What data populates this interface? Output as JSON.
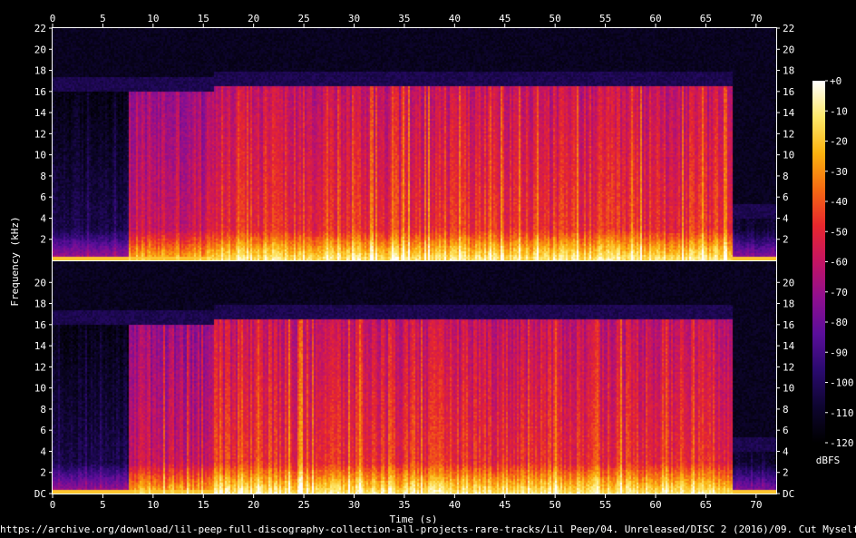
{
  "chart_data": {
    "type": "heatmap",
    "title": "",
    "xlabel": "Time (s)",
    "ylabel": "Frequency (kHz)",
    "xlim": [
      0,
      72
    ],
    "x_ticks": [
      0,
      5,
      10,
      15,
      20,
      25,
      30,
      35,
      40,
      45,
      50,
      55,
      60,
      65,
      70
    ],
    "channels": [
      {
        "ylim": [
          0,
          22
        ],
        "y_ticks": [
          {
            "value": 2,
            "label": "2"
          },
          {
            "value": 4,
            "label": "4"
          },
          {
            "value": 6,
            "label": "6"
          },
          {
            "value": 8,
            "label": "8"
          },
          {
            "value": 10,
            "label": "10"
          },
          {
            "value": 12,
            "label": "12"
          },
          {
            "value": 14,
            "label": "14"
          },
          {
            "value": 16,
            "label": "16"
          },
          {
            "value": 18,
            "label": "18"
          },
          {
            "value": 20,
            "label": "20"
          },
          {
            "value": 22,
            "label": "22"
          }
        ]
      },
      {
        "ylim": [
          0,
          22
        ],
        "y_ticks": [
          {
            "value": 0,
            "label": "DC"
          },
          {
            "value": 2,
            "label": "2"
          },
          {
            "value": 4,
            "label": "4"
          },
          {
            "value": 6,
            "label": "6"
          },
          {
            "value": 8,
            "label": "8"
          },
          {
            "value": 10,
            "label": "10"
          },
          {
            "value": 12,
            "label": "12"
          },
          {
            "value": 14,
            "label": "14"
          },
          {
            "value": 16,
            "label": "16"
          },
          {
            "value": 18,
            "label": "18"
          },
          {
            "value": 20,
            "label": "20"
          }
        ]
      }
    ],
    "colorbar": {
      "label": "dBFS",
      "range": [
        -120,
        0
      ],
      "ticks": [
        {
          "value": 0,
          "label": "+0"
        },
        {
          "value": -10,
          "label": "-10"
        },
        {
          "value": -20,
          "label": "-20"
        },
        {
          "value": -30,
          "label": "-30"
        },
        {
          "value": -40,
          "label": "-40"
        },
        {
          "value": -50,
          "label": "-50"
        },
        {
          "value": -60,
          "label": "-60"
        },
        {
          "value": -70,
          "label": "-70"
        },
        {
          "value": -80,
          "label": "-80"
        },
        {
          "value": -90,
          "label": "-90"
        },
        {
          "value": -100,
          "label": "-100"
        },
        {
          "value": -110,
          "label": "-110"
        },
        {
          "value": -120,
          "label": "-120"
        }
      ],
      "colors": [
        "#000000",
        "#0e0530",
        "#2a0a6e",
        "#5a0e9a",
        "#8f0f8f",
        "#c41463",
        "#e8272d",
        "#f56a12",
        "#fbb20f",
        "#fde86a",
        "#ffffff"
      ]
    },
    "segments": [
      {
        "t_start": 0,
        "t_end": 7.5,
        "level_db": -100,
        "cutoff_khz": 16
      },
      {
        "t_start": 7.5,
        "t_end": 16,
        "level_db": -55,
        "cutoff_khz": 16
      },
      {
        "t_start": 16,
        "t_end": 67.5,
        "level_db": -45,
        "cutoff_khz": 16.5
      },
      {
        "t_start": 67.5,
        "t_end": 72,
        "level_db": -105,
        "cutoff_khz": 4
      }
    ]
  },
  "source_url": "https://archive.org/download/lil-peep-full-discography-collection-all-projects-rare-tracks/Lil Peep/04. Unreleased/DISC 2 (2016)/09. Cut Myself.mp3"
}
